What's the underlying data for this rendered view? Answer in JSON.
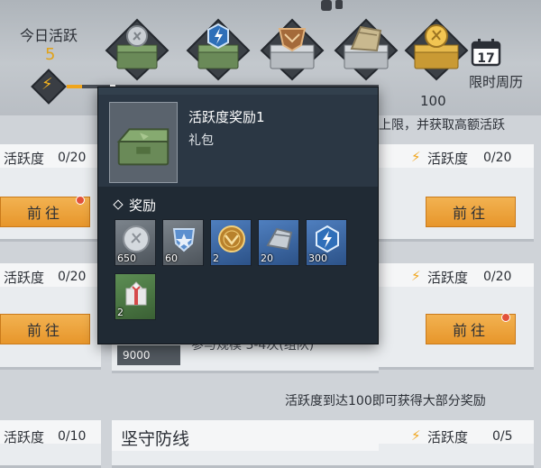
{
  "activity": {
    "label": "今日活跃",
    "value": "5",
    "max": 100,
    "milestone_label": "100",
    "chests": [
      {
        "name": "silver-chest-icon",
        "tone": "green"
      },
      {
        "name": "blue-chest-icon",
        "tone": "green"
      },
      {
        "name": "bronze-chest-icon",
        "tone": "silver"
      },
      {
        "name": "armor-chest-icon",
        "tone": "silver"
      },
      {
        "name": "gold-chest-icon",
        "tone": "gold"
      }
    ]
  },
  "calendar": {
    "day": "17",
    "label": "限时周历"
  },
  "popup": {
    "title": "活跃度奖励1",
    "subtitle": "礼包",
    "rewards_label": "奖励",
    "items": [
      {
        "icon": "silver-coin-icon",
        "count": "650"
      },
      {
        "icon": "blue-shield-icon",
        "count": "60"
      },
      {
        "icon": "gold-medal-icon",
        "count": "2"
      },
      {
        "icon": "steel-plate-icon",
        "count": "20"
      },
      {
        "icon": "energy-bolt-icon",
        "count": "300"
      },
      {
        "icon": "gift-box-icon",
        "count": "2"
      }
    ]
  },
  "tasks": {
    "pts_label": "活跃度",
    "go_label": "前往",
    "rows": [
      {
        "left_value": "0/20",
        "right_value": "0/20"
      },
      {
        "left_value": "0/20",
        "right_value": "0/20"
      },
      {
        "left_value": "0/10",
        "right_value": "0/5"
      }
    ],
    "partial_hint_top": "上限，并获取高额活跃",
    "partial_hint_mid": "参与规模 3-4次(组队)",
    "hint_bottom": "活跃度到达100即可获得大部分奖励",
    "card_title": "坚守防线",
    "hidden_reward_count": "9000"
  },
  "colors": {
    "accent": "#f0a51c",
    "button": "#e7962b",
    "popup_bg": "#202a34"
  }
}
